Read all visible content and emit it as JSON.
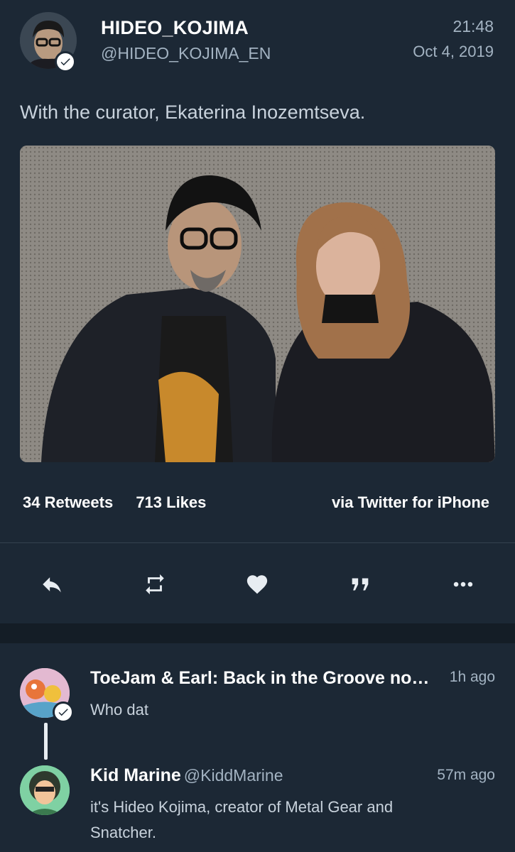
{
  "tweet": {
    "display_name": "HIDEO_KOJIMA",
    "handle": "@HIDEO_KOJIMA_EN",
    "time": "21:48",
    "date": "Oct 4, 2019",
    "text": "With the curator, Ekaterina Inozemtseva.",
    "retweets": "34 Retweets",
    "likes": "713 Likes",
    "via": "via Twitter for iPhone"
  },
  "actions": [
    {
      "name": "reply-icon"
    },
    {
      "name": "retweet-icon"
    },
    {
      "name": "like-icon"
    },
    {
      "name": "quote-icon"
    },
    {
      "name": "more-icon"
    }
  ],
  "replies": [
    {
      "name": "ToeJam & Earl: Back in the Groove no…",
      "handle": "",
      "time": "1h ago",
      "text": "Who dat",
      "verified": true
    },
    {
      "name": "Kid Marine",
      "handle": "@KiddMarine",
      "time": "57m ago",
      "text": "it's Hideo Kojima, creator of Metal Gear and Snatcher.",
      "verified": false
    }
  ],
  "colors": {
    "background": "#1c2835",
    "secondary_text": "#a3b3c2",
    "divider": "#34424f"
  }
}
